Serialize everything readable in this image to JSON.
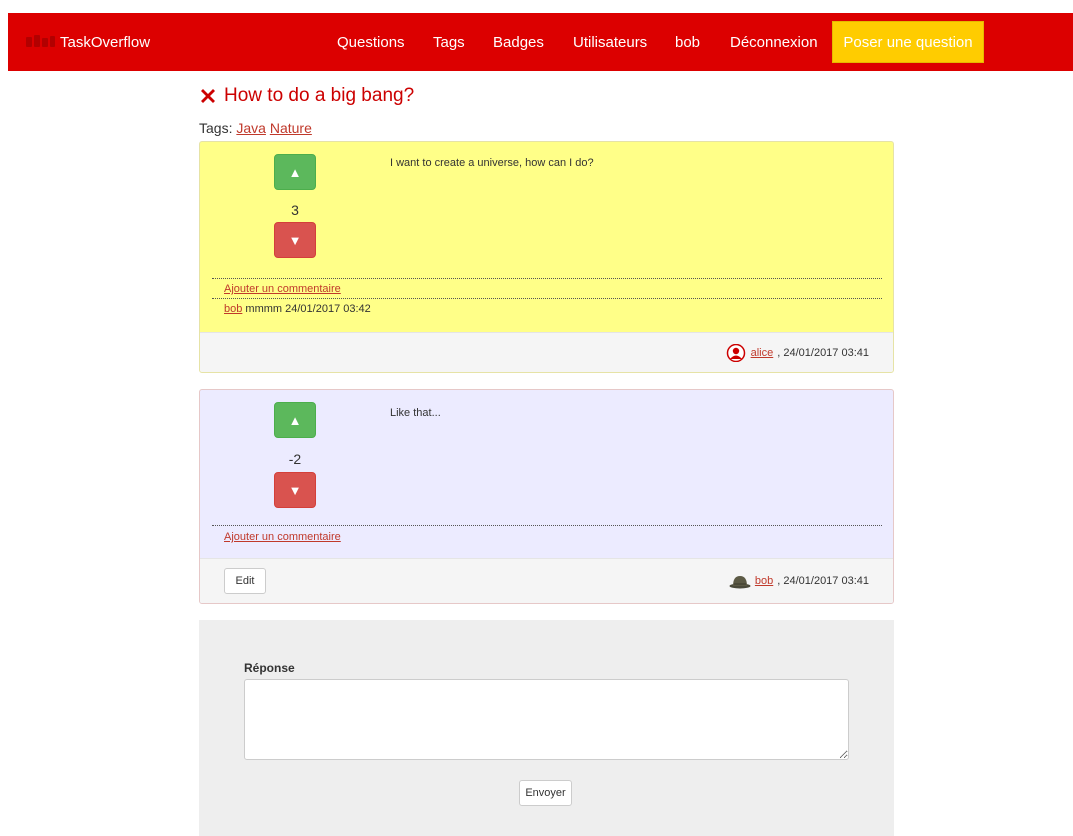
{
  "app": {
    "brand": "TaskOverflow"
  },
  "nav": {
    "questions": "Questions",
    "tags": "Tags",
    "badges": "Badges",
    "users": "Utilisateurs",
    "user": "bob",
    "logout": "Déconnexion",
    "ask": "Poser une question"
  },
  "question": {
    "title": "How to do a big bang?",
    "tags_label": "Tags:",
    "tags": [
      "Java",
      "Nature"
    ],
    "votes": "3",
    "body": "I want to create a universe, how can I do?",
    "add_comment": "Ajouter un commentaire",
    "comment": {
      "author": "bob",
      "text": "mmmm 24/01/2017 03:42"
    },
    "author": "alice",
    "date": ", 24/01/2017 03:41"
  },
  "answer": {
    "votes": "-2",
    "body": "Like that...",
    "add_comment": "Ajouter un commentaire",
    "edit": "Edit",
    "author": "bob",
    "date": ", 24/01/2017 03:41"
  },
  "form": {
    "label": "Réponse",
    "value": "",
    "send": "Envoyer"
  },
  "icons": {
    "up": "▲",
    "down": "▼"
  },
  "colors": {
    "brand": "#dc0000",
    "ask_button": "#ffcc00",
    "question_bg": "#ffff88",
    "answer_bg": "#ecebff",
    "vote_up": "#5cb85c",
    "vote_down": "#d9534f",
    "link": "#c0392b"
  }
}
